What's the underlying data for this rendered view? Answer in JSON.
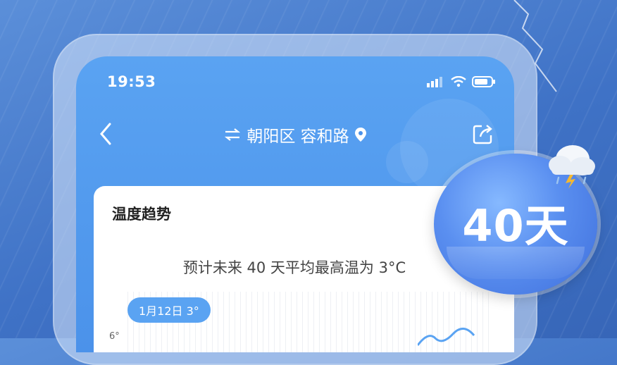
{
  "status_bar": {
    "time": "19:53"
  },
  "nav": {
    "location": "朝阳区 容和路"
  },
  "card": {
    "title": "温度趋势",
    "subtitle": "预计未来 40 天平均最高温为 3°C",
    "tooltip": "1月12日 3°",
    "y_tick": "6°"
  },
  "badge": {
    "text": "40天"
  },
  "colors": {
    "background": "#4a7fd0",
    "screen": "#5aa3f2",
    "accent": "#5aa3f2",
    "badge": "#4f82e8"
  },
  "icons": [
    "back-icon",
    "swap-icon",
    "location-pin-icon",
    "share-icon",
    "signal-icon",
    "wifi-icon",
    "battery-icon",
    "storm-cloud-icon",
    "lightning-icon"
  ]
}
